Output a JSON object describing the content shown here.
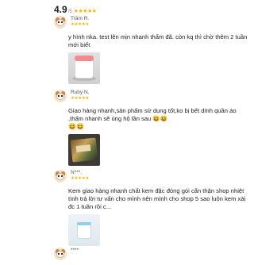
{
  "header": {
    "score": "4.9",
    "suffix": "/5",
    "stars": "★★★★★"
  },
  "colors": {
    "star": "#f7b500"
  },
  "reviews": [
    {
      "name": "Trâm R.",
      "stars": "★★★★★",
      "text": "y hình nka. test lên mịn nhanh thấm đã. còn kq thì chờ thêm 2 tuần mới biết",
      "emojis": "",
      "photo": "cream-jar-photo"
    },
    {
      "name": "Ruby N.",
      "stars": "★★★★★",
      "text": "Giao hàng nhanh,sản phẩm sử dụng tốt,ko bị bết dính quần áo ,thấm nhanh sẽ ủng hộ lần sau 😆😆",
      "emojis": "😆😆",
      "photo": "product-package-photo"
    },
    {
      "name": "N***.",
      "stars": "★★★★★",
      "text": "Kem giao hàng nhanh chất kem đặc đóng gói cẩn thận shop nhiệt tình trả lời tư vấn cho mình nên mình cho shop 5 sao luôn kem xài đc 1 tuần rồi c...",
      "emojis": "",
      "photo": "jar-on-table-photo"
    },
    {
      "name": "****",
      "stars": "",
      "text": "",
      "emojis": "",
      "photo": ""
    }
  ]
}
